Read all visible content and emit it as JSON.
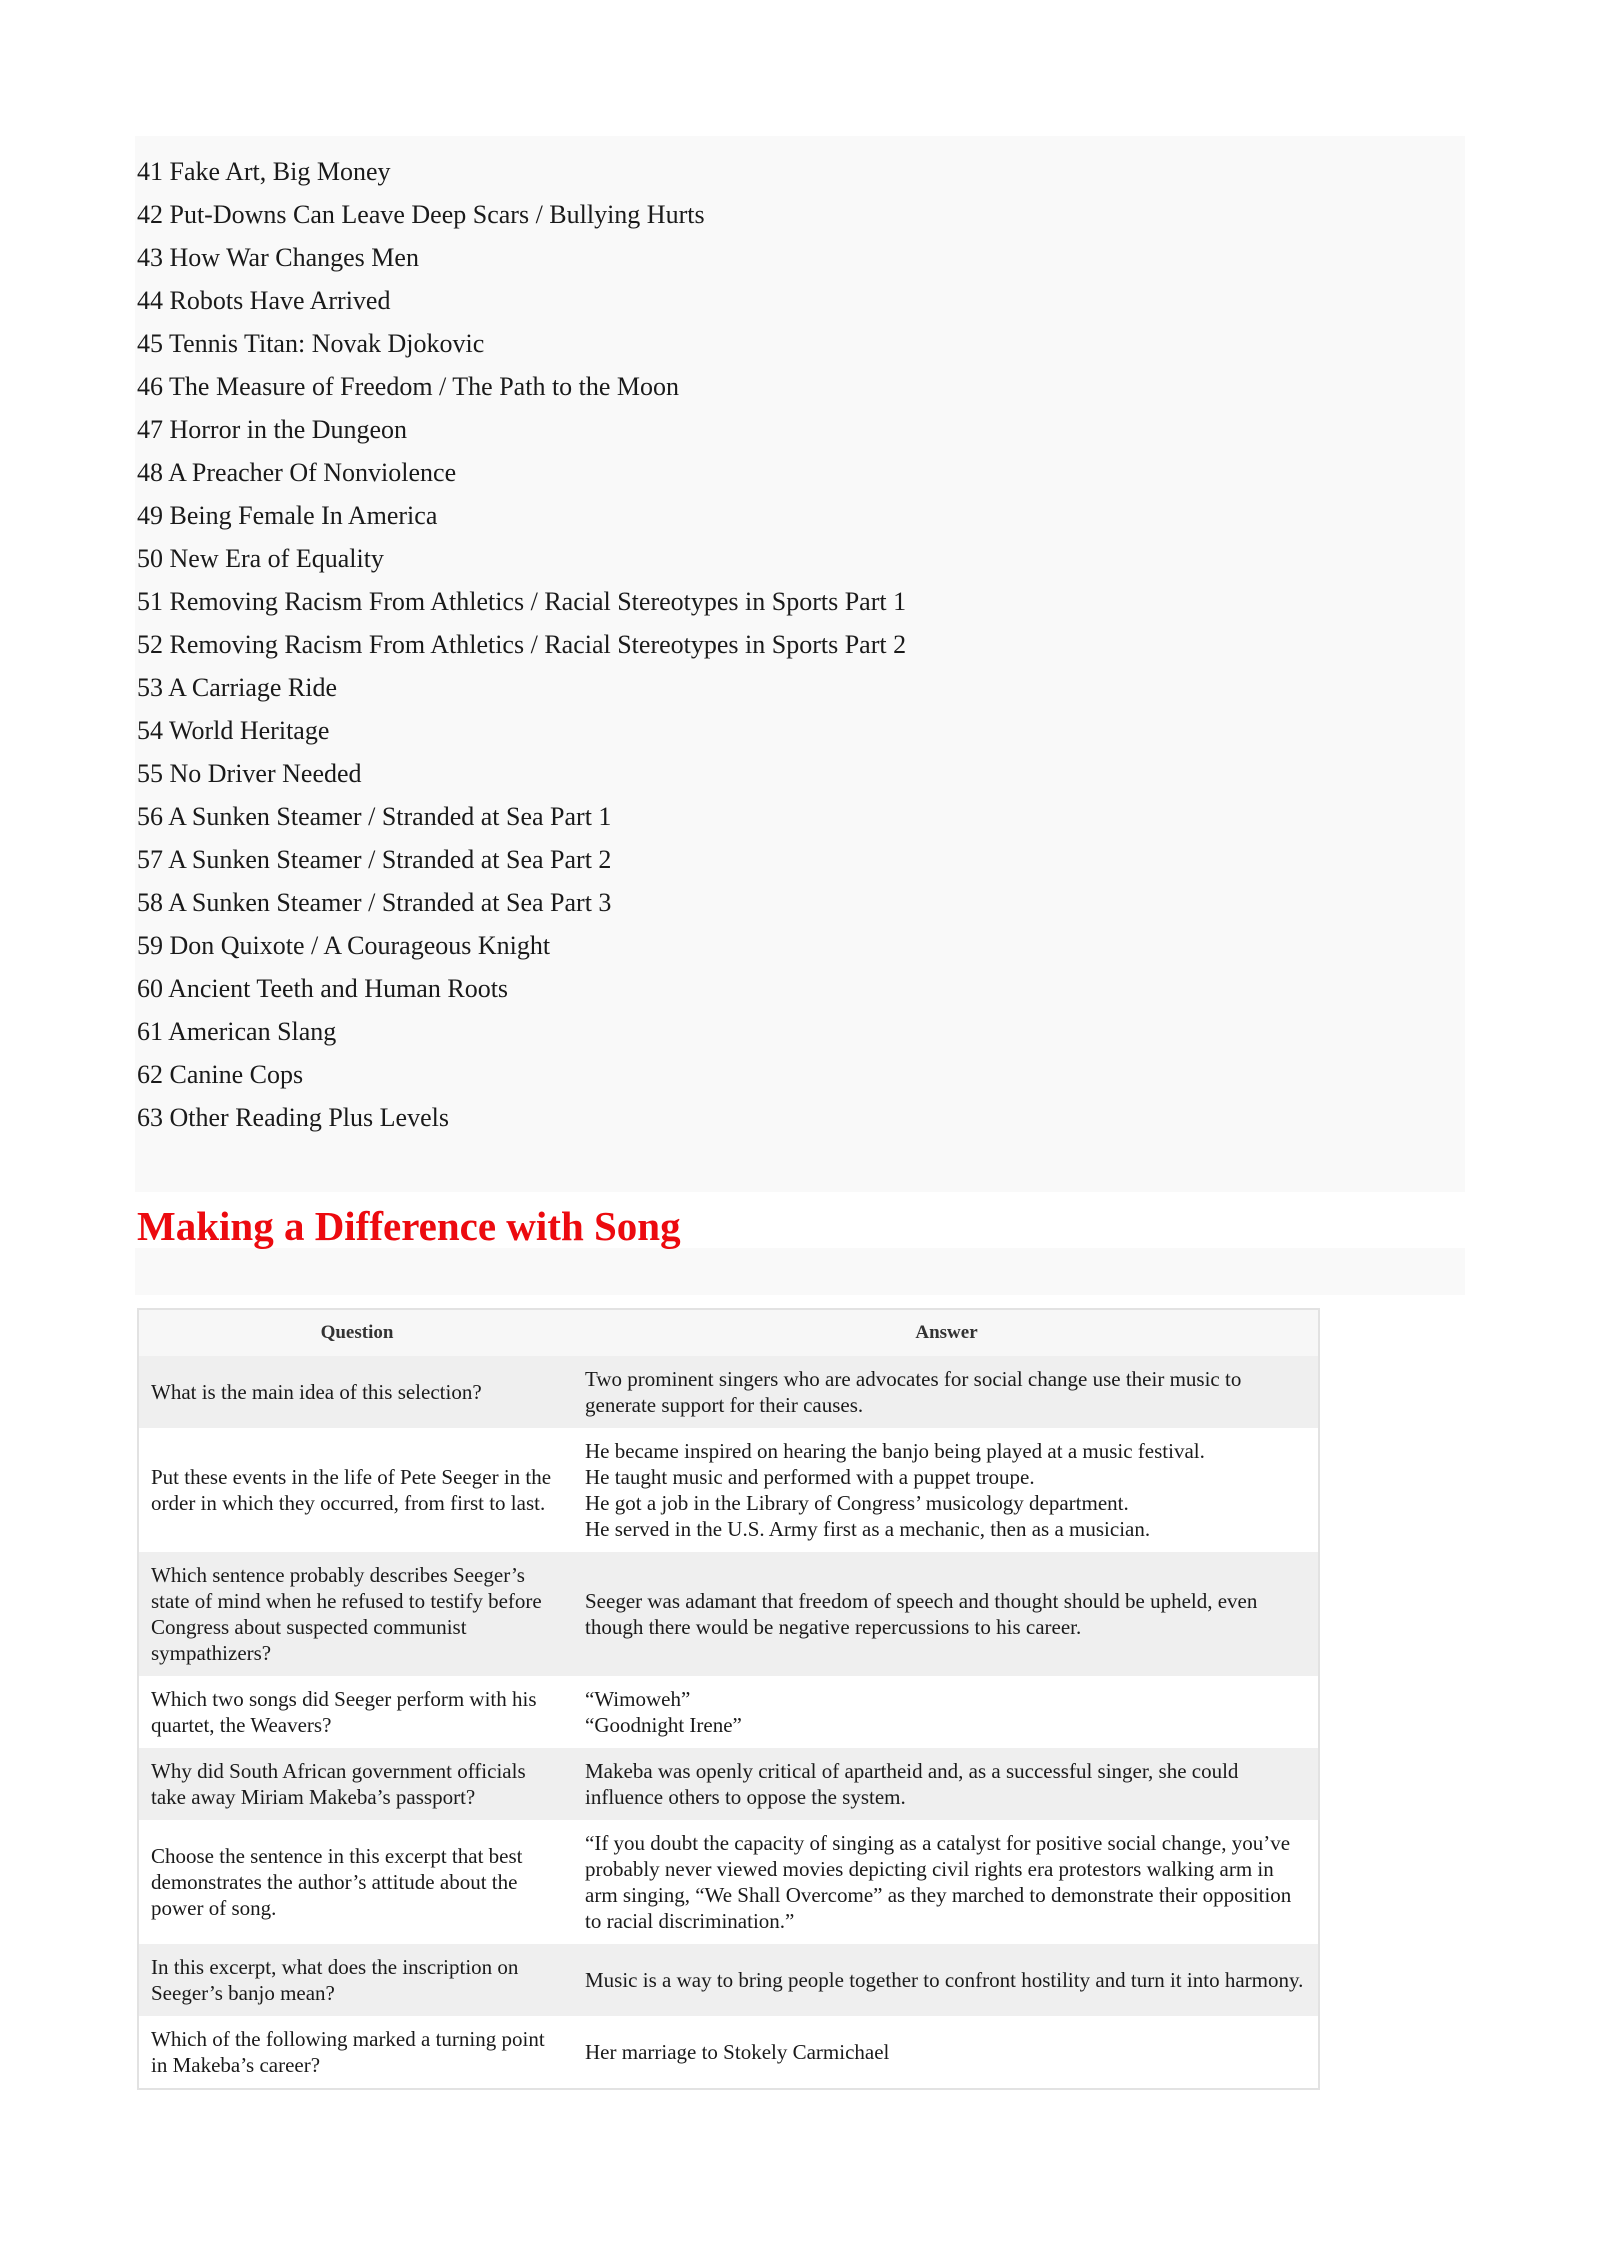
{
  "list": {
    "items": [
      "41 Fake Art, Big Money",
      "42 Put-Downs Can Leave Deep Scars / Bullying Hurts",
      "43 How War Changes Men",
      "44 Robots Have Arrived",
      "45 Tennis Titan: Novak Djokovic",
      "46 The Measure of Freedom / The Path to the Moon",
      "47 Horror in the Dungeon",
      "48 A Preacher Of Nonviolence",
      "49 Being Female In America",
      "50 New Era of Equality",
      "51 Removing Racism From Athletics / Racial Stereotypes in Sports Part 1",
      "52 Removing Racism From Athletics / Racial Stereotypes in Sports Part 2",
      "53 A Carriage Ride",
      "54 World Heritage",
      "55 No Driver Needed",
      "56 A Sunken Steamer / Stranded at Sea Part 1",
      "57 A Sunken Steamer / Stranded at Sea Part 2",
      "58 A Sunken Steamer / Stranded at Sea Part 3",
      "59 Don Quixote / A Courageous Knight",
      "60 Ancient Teeth and Human Roots",
      "61 American Slang",
      "62 Canine Cops",
      "63 Other Reading Plus Levels"
    ]
  },
  "section": {
    "title": "Making a Difference with Song",
    "title_color": "#ec0a0f"
  },
  "table": {
    "headers": [
      "Question",
      "Answer"
    ],
    "rows": [
      {
        "question": "What is the main idea of this selection?",
        "answer": [
          "Two prominent singers who are advocates for social change use their music to generate support for their causes."
        ]
      },
      {
        "question": "Put these events in the life of Pete Seeger in the order in which they occurred, from first to last.",
        "answer": [
          "He became inspired on hearing the banjo being played at a music festival.",
          "He taught music and performed with a puppet troupe.",
          "He got a job in the Library of Congress’ musicology department.",
          "He served in the U.S. Army first as a mechanic, then as a musician."
        ]
      },
      {
        "question": "Which sentence probably describes Seeger’s state of mind when he refused to testify before Congress about suspected communist sympathizers?",
        "answer": [
          "Seeger was adamant that freedom of speech and thought should be upheld, even though there would be negative repercussions to his career."
        ]
      },
      {
        "question": "Which two songs did Seeger perform with his quartet, the Weavers?",
        "answer": [
          "“Wimoweh”",
          "“Goodnight Irene”"
        ]
      },
      {
        "question": "Why did South African government officials take away Miriam Makeba’s passport?",
        "answer": [
          "Makeba was openly critical of apartheid and, as a successful singer, she could influence others to oppose the system."
        ]
      },
      {
        "question": "Choose the sentence in this excerpt that best demonstrates the author’s attitude about the power of song.",
        "answer": [
          "“If you doubt the capacity of singing as a catalyst for positive social change, you’ve probably never viewed movies depicting civil rights era protestors walking arm in arm singing, “We Shall Overcome” as they marched to demonstrate their opposition to racial discrimination.”"
        ]
      },
      {
        "question": "In this excerpt, what does the inscription on Seeger’s banjo mean?",
        "answer": [
          "Music is a way to bring people together to confront hostility and turn it into harmony."
        ]
      },
      {
        "question": "Which of the following marked a turning point in Makeba’s career?",
        "answer": [
          "Her marriage to Stokely Carmichael"
        ]
      }
    ]
  }
}
